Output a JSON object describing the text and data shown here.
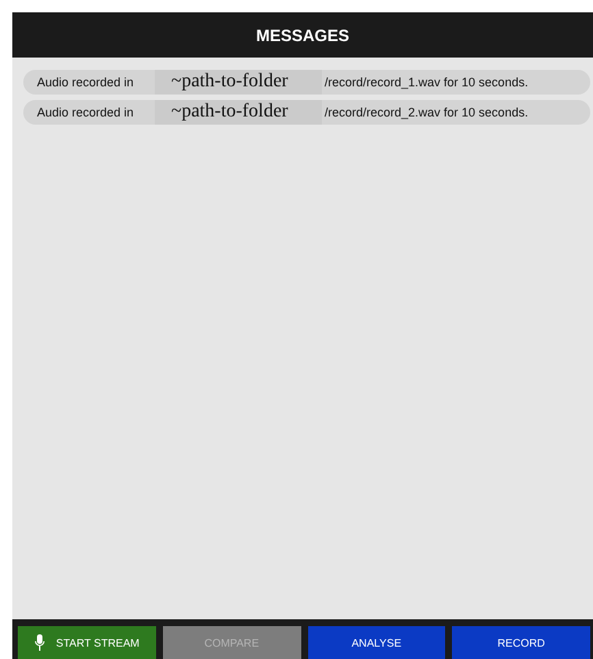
{
  "header": {
    "title": "MESSAGES"
  },
  "messages": [
    {
      "prefix": "Audio recorded in",
      "path": "~path-to-folder",
      "suffix": "/record/record_1.wav for 10 seconds."
    },
    {
      "prefix": "Audio recorded in",
      "path": "~path-to-folder",
      "suffix": "/record/record_2.wav for 10 seconds."
    }
  ],
  "buttons": [
    {
      "label": "START STREAM",
      "kind": "mic",
      "color": "#2e7a1f",
      "disabled": false
    },
    {
      "label": "COMPARE",
      "kind": "plain",
      "color": "#7d7d7d",
      "disabled": true
    },
    {
      "label": "ANALYSE",
      "kind": "plain",
      "color": "#0b3ac4",
      "disabled": false
    },
    {
      "label": "RECORD",
      "kind": "plain",
      "color": "#0b3ac4",
      "disabled": false
    }
  ]
}
